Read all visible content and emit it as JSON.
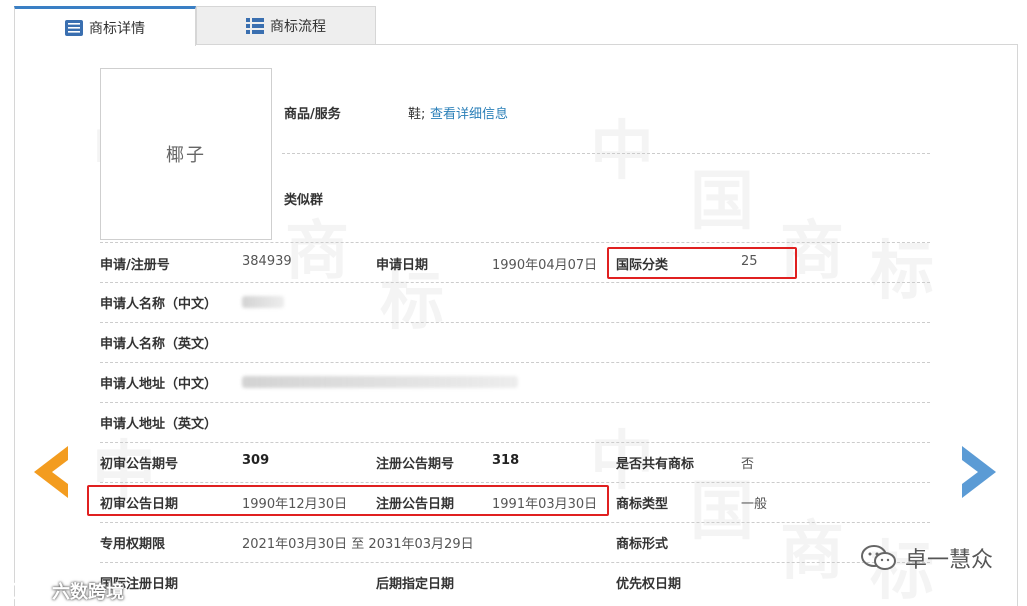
{
  "tabs": {
    "details": "商标详情",
    "process": "商标流程"
  },
  "logo": {
    "text": "椰子"
  },
  "goods": {
    "label": "商品/服务",
    "value": "鞋;",
    "link": "查看详细信息"
  },
  "similar": {
    "label": "类似群"
  },
  "rows": {
    "reg_no_label": "申请/注册号",
    "reg_no": "384939",
    "apply_date_label": "申请日期",
    "apply_date": "1990年04月07日",
    "intl_class_label": "国际分类",
    "intl_class": "25",
    "applicant_cn_label": "申请人名称（中文）",
    "applicant_en_label": "申请人名称（英文）",
    "address_cn_label": "申请人地址（中文）",
    "address_en_label": "申请人地址（英文）",
    "prelim_no_label": "初审公告期号",
    "prelim_no": "309",
    "reg_pub_no_label": "注册公告期号",
    "reg_pub_no": "318",
    "shared_label": "是否共有商标",
    "shared": "否",
    "prelim_date_label": "初审公告日期",
    "prelim_date": "1990年12月30日",
    "reg_pub_date_label": "注册公告日期",
    "reg_pub_date": "1991年03月30日",
    "type_label": "商标类型",
    "type": "一般",
    "term_label": "专用权期限",
    "term": "2021年03月30日 至 2031年03月29日",
    "form_label": "商标形式",
    "intl_reg_date_label": "国际注册日期",
    "later_date_label": "后期指定日期",
    "priority_date_label": "优先权日期"
  },
  "watermark": {
    "chars": [
      "中",
      "国",
      "商",
      "标"
    ]
  },
  "branding": {
    "right": "卓一慧众",
    "left": "六数跨境"
  },
  "colors": {
    "accent_blue": "#3a7fc4",
    "highlight_red": "#e02020",
    "arrow_orange": "#f39c1f",
    "arrow_blue": "#5b9bd5"
  }
}
